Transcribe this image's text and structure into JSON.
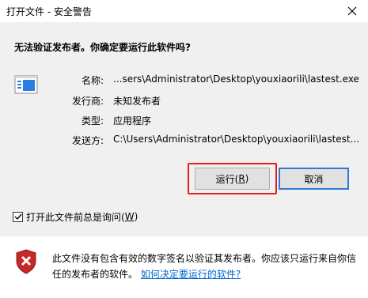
{
  "window": {
    "title": "打开文件 - 安全警告"
  },
  "headline": "无法验证发布者。你确定要运行此软件吗?",
  "details": [
    {
      "label": "名称:",
      "value": "...sers\\Administrator\\Desktop\\youxiaorili\\lastest.exe"
    },
    {
      "label": "发行商:",
      "value": "未知发布者"
    },
    {
      "label": "类型:",
      "value": "应用程序"
    },
    {
      "label": "发送方:",
      "value": "C:\\Users\\Administrator\\Desktop\\youxiaorili\\lastest..."
    }
  ],
  "buttons": {
    "run_label": "运行(",
    "run_mnemonic": "R",
    "run_suffix": ")",
    "cancel_label": "取消"
  },
  "checkbox": {
    "label": "打开此文件前总是询问(",
    "mnemonic": "W",
    "suffix": ")",
    "checked": true
  },
  "footer": {
    "message": "此文件没有包含有效的数字签名以验证其发布者。你应该只运行来自你信任的发布者的软件。",
    "link": "如何决定要运行的软件?"
  },
  "colors": {
    "content_bg": "#f0f0f0",
    "highlight": "#e02020",
    "default_button_border": "#2f7ad8",
    "link": "#0066cc"
  },
  "icons": {
    "file": "application-file-icon",
    "shield": "security-warning-shield-icon",
    "close": "close-icon"
  }
}
